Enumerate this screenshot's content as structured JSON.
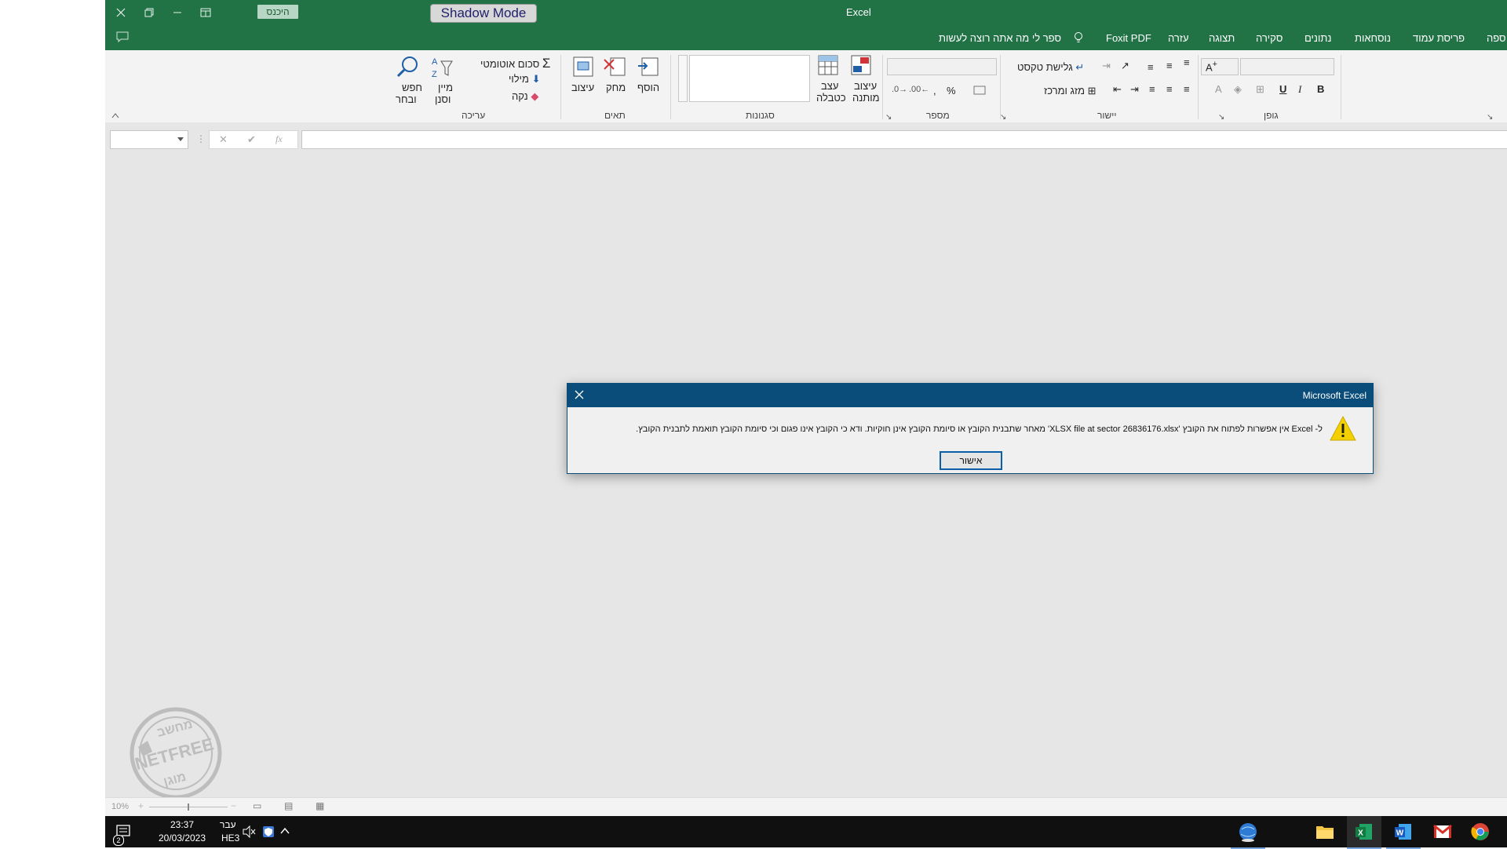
{
  "app": {
    "title": "Excel"
  },
  "titlebar": {
    "signin_label": "היכנס",
    "shadow_mode_label": "Shadow Mode"
  },
  "tabs": [
    "ספה",
    "פריסת עמוד",
    "נוסחאות",
    "נתונים",
    "סקירה",
    "תצוגה",
    "עזרה",
    "Foxit PDF"
  ],
  "tell_me": {
    "placeholder": "ספר לי מה אתה רוצה לעשות"
  },
  "ribbon": {
    "groups": {
      "font": "גופן",
      "alignment": "יישור",
      "number": "מספר",
      "styles": "סגנונות",
      "cells": "תאים",
      "editing": "עריכה"
    },
    "alignment": {
      "wrap_text": "גלישת טקסט",
      "merge_center": "מזג ומרכז"
    },
    "styles": {
      "conditional_1": "עיצוב",
      "conditional_2": "מותנה",
      "format_table_1": "עצב",
      "format_table_2": "כטבלה"
    },
    "cells": {
      "insert": "הוסף",
      "delete": "מחק",
      "format": "עיצוב"
    },
    "editing": {
      "autosum": "סכום אוטומטי",
      "fill": "מילוי",
      "clear": "נקה",
      "sort_1": "מיין",
      "sort_2": "וסנן",
      "find_1": "חפש",
      "find_2": "ובחר"
    },
    "number": {
      "percent": "%",
      "comma": ","
    },
    "font": {
      "bold": "B",
      "italic": "I",
      "underline": "U"
    }
  },
  "formula_bar": {
    "fx": "fx"
  },
  "dialog": {
    "title": "Microsoft Excel",
    "message": "ל- Excel אין אפשרות לפתוח את הקובץ 'XLSX file at sector 26836176.xlsx' מאחר שתבנית הקובץ או סיומת הקובץ אינן חוקיות. ודא כי הקובץ אינו פגום וכי סיומת הקובץ תואמת לתבנית הקובץ.",
    "ok_label": "אישור"
  },
  "watermark": {
    "text_top": "מחשב",
    "text_mid": "NETFREE",
    "text_bottom": "מוגן"
  },
  "statusbar": {
    "zoom": "10%"
  },
  "taskbar": {
    "time": "23:37",
    "date": "20/03/2023",
    "lang_1": "עבר",
    "lang_2": "HE3",
    "notification_count": "2"
  },
  "colors": {
    "excel_green": "#217346",
    "dialog_blue": "#0a4d7a",
    "taskbar": "#101010"
  }
}
